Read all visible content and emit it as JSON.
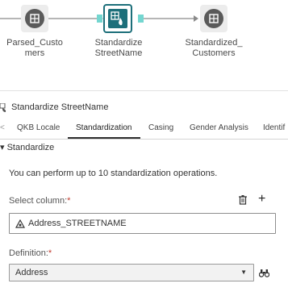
{
  "flow": {
    "nodes": [
      {
        "label_line1": "Parsed_Custo",
        "label_line2": "mers",
        "icon": "table-node-icon"
      },
      {
        "label_line1": "Standardize",
        "label_line2": "StreetName",
        "icon": "standardize-node-icon"
      },
      {
        "label_line1": "Standardized_",
        "label_line2": "Customers",
        "icon": "table-node-icon"
      }
    ]
  },
  "panel": {
    "title": "Standardize StreetName",
    "title_icon": "standardize-node-icon",
    "tabs": [
      "QKB Locale",
      "Standardization",
      "Casing",
      "Gender Analysis",
      "Identif"
    ],
    "active_tab": "Standardization",
    "section": {
      "label": "Standardize",
      "info_text": "You can perform up to 10 standardization operations.",
      "select_column_label": "Select column:",
      "required_marker": "*",
      "column_value": "Address_STREETNAME",
      "definition_label": "Definition:",
      "definition_value": "Address"
    }
  },
  "colors": {
    "accent": "#1d6f7a",
    "port": "#74d6d0",
    "required": "#c0392b"
  }
}
